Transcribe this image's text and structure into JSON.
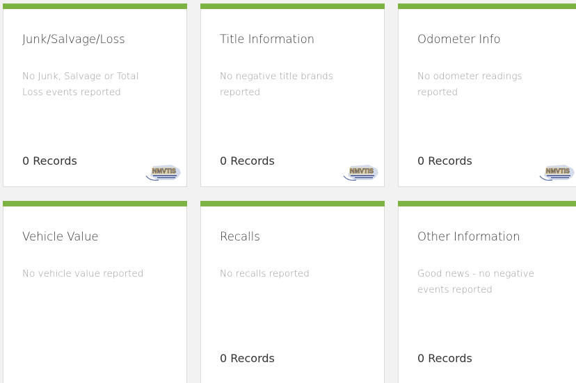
{
  "colors": {
    "accent_bar": "#7cb342",
    "card_bg": "#ffffff",
    "title_text": "#333333",
    "desc_text": "#9a9a9a"
  },
  "cards": [
    {
      "title": "Junk/Salvage/Loss",
      "description": "No Junk, Salvage or Total Loss events reported",
      "records": "0 Records",
      "logo_text": "NMVTIS",
      "logo_icon": "nmvtis-logo-icon"
    },
    {
      "title": "Title Information",
      "description": "No negative title brands reported",
      "records": "0 Records",
      "logo_text": "NMVTIS",
      "logo_icon": "nmvtis-logo-icon"
    },
    {
      "title": "Odometer Info",
      "description": "No odometer readings reported",
      "records": "0 Records",
      "logo_text": "NMVTIS",
      "logo_icon": "nmvtis-logo-icon"
    },
    {
      "title": "Vehicle Value",
      "description": "No vehicle value reported"
    },
    {
      "title": "Recalls",
      "description": "No recalls reported",
      "records": "0 Records"
    },
    {
      "title": "Other Information",
      "description": "Good news - no negative events reported",
      "records": "0 Records"
    }
  ]
}
